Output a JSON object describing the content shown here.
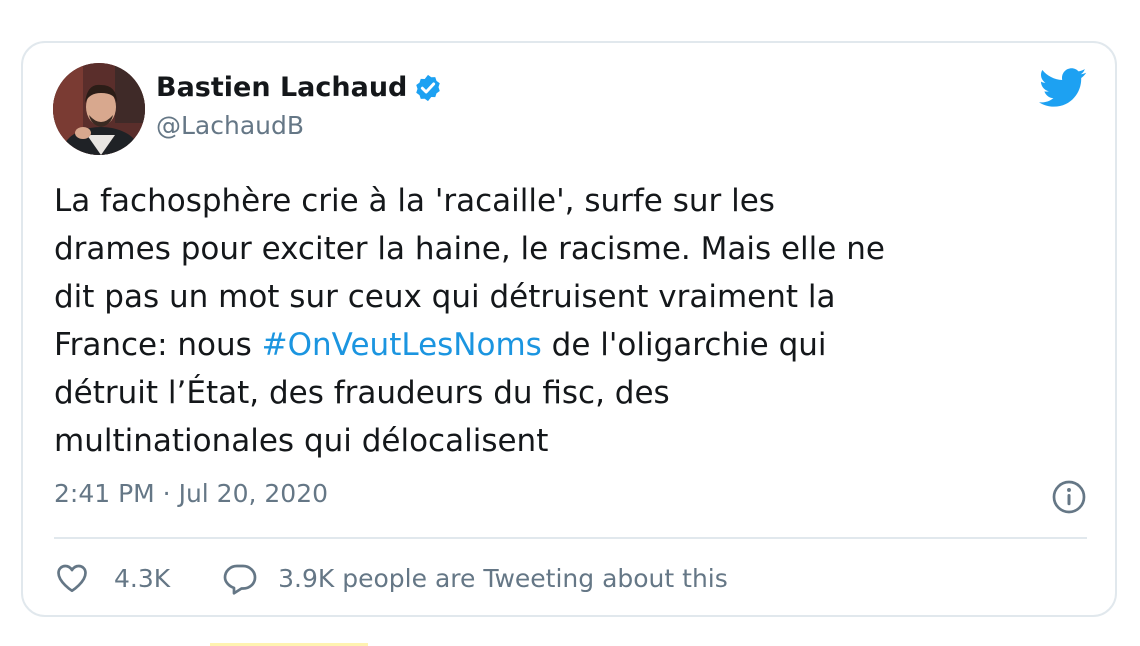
{
  "tweet": {
    "author_name": "Bastien Lachaud",
    "handle": "@LachaudB",
    "verified_icon": "verified-badge-icon",
    "text_before": "La fachosphère crie à la 'racaille', surfe sur les\ndrames pour exciter la haine, le racisme. Mais elle ne\ndit pas un mot sur ceux qui détruisent vraiment la\nFrance: nous ",
    "hashtag": "#OnVeutLesNoms",
    "text_after": " de l'oligarchie qui\ndétruit l’État, des fraudeurs du fisc, des\nmultinationales qui délocalisent",
    "timestamp": "2:41 PM · Jul 20, 2020",
    "likes": "4.3K",
    "conversation": "3.9K people are Tweeting about this"
  },
  "colors": {
    "text": "#14171a",
    "muted": "#657786",
    "link": "#1b95e0",
    "twitter_blue": "#1da1f2",
    "border": "#e1e8ed"
  },
  "icons": [
    "twitter-bird-icon",
    "info-icon",
    "heart-icon",
    "reply-bubble-icon",
    "verified-badge-icon"
  ]
}
